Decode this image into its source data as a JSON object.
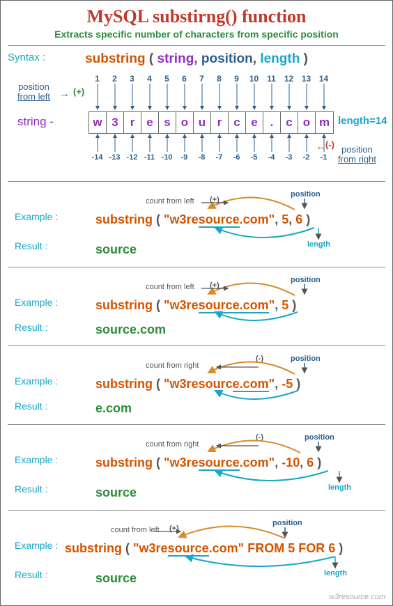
{
  "title": "MySQL substirng() function",
  "subtitle": "Extracts specific number of characters from specific position",
  "syntax_label": "Syntax :",
  "syntax": {
    "fn": "substring",
    "open": "(",
    "arg1": "string",
    "c1": ",",
    "arg2": "position",
    "c2": ",",
    "arg3": "length",
    "close": ")"
  },
  "diagram": {
    "string_label": "string -",
    "chars": [
      "w",
      "3",
      "r",
      "e",
      "s",
      "o",
      "u",
      "r",
      "c",
      "e",
      ".",
      "c",
      "o",
      "m"
    ],
    "top_nums": [
      "1",
      "2",
      "3",
      "4",
      "5",
      "6",
      "7",
      "8",
      "9",
      "10",
      "11",
      "12",
      "13",
      "14"
    ],
    "bot_nums": [
      "-14",
      "-13",
      "-12",
      "-11",
      "-10",
      "-9",
      "-8",
      "-7",
      "-6",
      "-5",
      "-4",
      "-3",
      "-2",
      "-1"
    ],
    "length_label": "length=14",
    "pos_left_label_l1": "position",
    "pos_left_label_l2": "from left",
    "pos_right_label_l1": "position",
    "pos_right_label_l2": "from right",
    "plus": "(+)",
    "minus": "(-)"
  },
  "examples": [
    {
      "label": "Example :",
      "count_note": "count from left",
      "count_sign": "(+)",
      "sign_color": "plus",
      "expr_fn": "substring",
      "expr_open": "(",
      "expr_str": "\"w3resource.com\"",
      "expr_c1": ",",
      "expr_pos": "5",
      "expr_c2": ",",
      "expr_len": "6",
      "expr_close": ")",
      "pos_note": "position",
      "len_note": "length",
      "result_label": "Result :",
      "result": "source",
      "underline_start": 4,
      "underline_len": 6
    },
    {
      "label": "Example :",
      "count_note": "count from left",
      "count_sign": "(+)",
      "sign_color": "plus",
      "expr_fn": "substring",
      "expr_open": "(",
      "expr_str": "\"w3resource.com\"",
      "expr_c1": ",",
      "expr_pos": "5",
      "expr_c2": "",
      "expr_len": "",
      "expr_close": ")",
      "pos_note": "position",
      "len_note": "",
      "result_label": "Result :",
      "result": "source.com",
      "underline_start": 4,
      "underline_len": 10
    },
    {
      "label": "Example :",
      "count_note": "count from right",
      "count_sign": "(-)",
      "sign_color": "minus",
      "expr_fn": "substring",
      "expr_open": "(",
      "expr_str": "\"w3resource.com\"",
      "expr_c1": ",",
      "expr_pos": "-5",
      "expr_c2": "",
      "expr_len": "",
      "expr_close": ")",
      "pos_note": "position",
      "len_note": "",
      "result_label": "Result :",
      "result": "e.com",
      "underline_start": 9,
      "underline_len": 5
    },
    {
      "label": "Example :",
      "count_note": "count from right",
      "count_sign": "(-)",
      "sign_color": "minus",
      "expr_fn": "substring",
      "expr_open": "(",
      "expr_str": "\"w3resource.com\"",
      "expr_c1": ",",
      "expr_pos": "-10",
      "expr_c2": ",",
      "expr_len": "6",
      "expr_close": ")",
      "pos_note": "position",
      "len_note": "length",
      "result_label": "Result :",
      "result": "source",
      "underline_start": 4,
      "underline_len": 6
    },
    {
      "label": "Example :",
      "count_note": "count from left",
      "count_sign": "(+)",
      "sign_color": "plus",
      "expr_fn": "substring",
      "expr_open": "(",
      "expr_str": "\"w3resource.com\"",
      "expr_from": "FROM",
      "expr_pos": "5",
      "expr_for": "FOR",
      "expr_len": "6",
      "expr_close": ")",
      "pos_note": "position",
      "len_note": "length",
      "result_label": "Result :",
      "result": "source",
      "underline_start": 4,
      "underline_len": 6,
      "from_for": true
    }
  ],
  "footer": "w3resource.com"
}
